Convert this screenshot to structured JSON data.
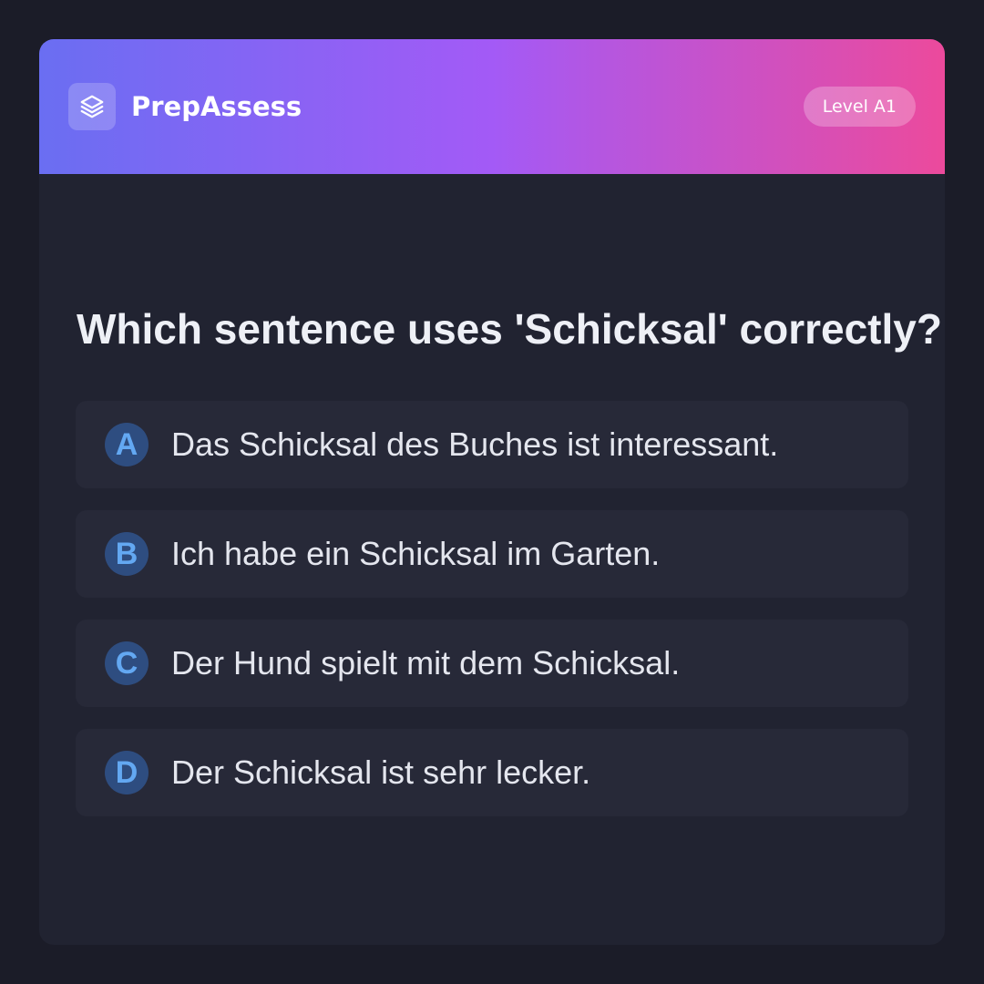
{
  "header": {
    "brand": "PrepAssess",
    "logo_icon": "layers-icon",
    "level_badge": "Level A1"
  },
  "question": "Which sentence uses 'Schicksal' correctly?",
  "options": [
    {
      "letter": "A",
      "text": "Das Schicksal des Buches ist interessant."
    },
    {
      "letter": "B",
      "text": "Ich habe ein Schicksal im Garten."
    },
    {
      "letter": "C",
      "text": "Der Hund spielt mit dem Schicksal."
    },
    {
      "letter": "D",
      "text": "Der Schicksal ist sehr lecker."
    }
  ],
  "colors": {
    "page_background": "#1b1c28",
    "card_background": "#212331",
    "option_background": "#272938",
    "gradient_start": "#6a6ef2",
    "gradient_mid": "#a35af6",
    "gradient_end": "#ec4a9c",
    "letter_circle": "#2e4d80",
    "letter_text": "#63a8f2"
  }
}
